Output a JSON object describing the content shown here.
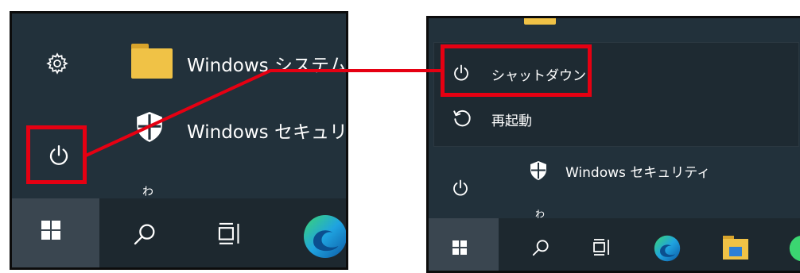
{
  "left_panel": {
    "start_menu": {
      "folder_item": {
        "label": "Windows システム"
      },
      "security_item": {
        "label": "Windows セキュリ"
      }
    },
    "partial_letter": "わ"
  },
  "right_panel": {
    "power_menu": {
      "shutdown": {
        "label": "シャットダウン"
      },
      "restart": {
        "label": "再起動"
      }
    },
    "start_menu": {
      "security_item": {
        "label": "Windows セキュリティ"
      }
    },
    "partial_letter": "わ"
  },
  "colors": {
    "highlight": "#e60012",
    "taskbar": "#1d282f",
    "start_menu_bg": "#22313b",
    "folder": "#f0c246"
  },
  "icons": {
    "settings": "gear-icon",
    "power": "power-icon",
    "restart": "restart-icon",
    "shield": "shield-icon",
    "start": "windows-logo-icon",
    "search": "search-icon",
    "task_view": "task-view-icon",
    "edge": "edge-browser-icon",
    "explorer": "file-explorer-icon"
  }
}
